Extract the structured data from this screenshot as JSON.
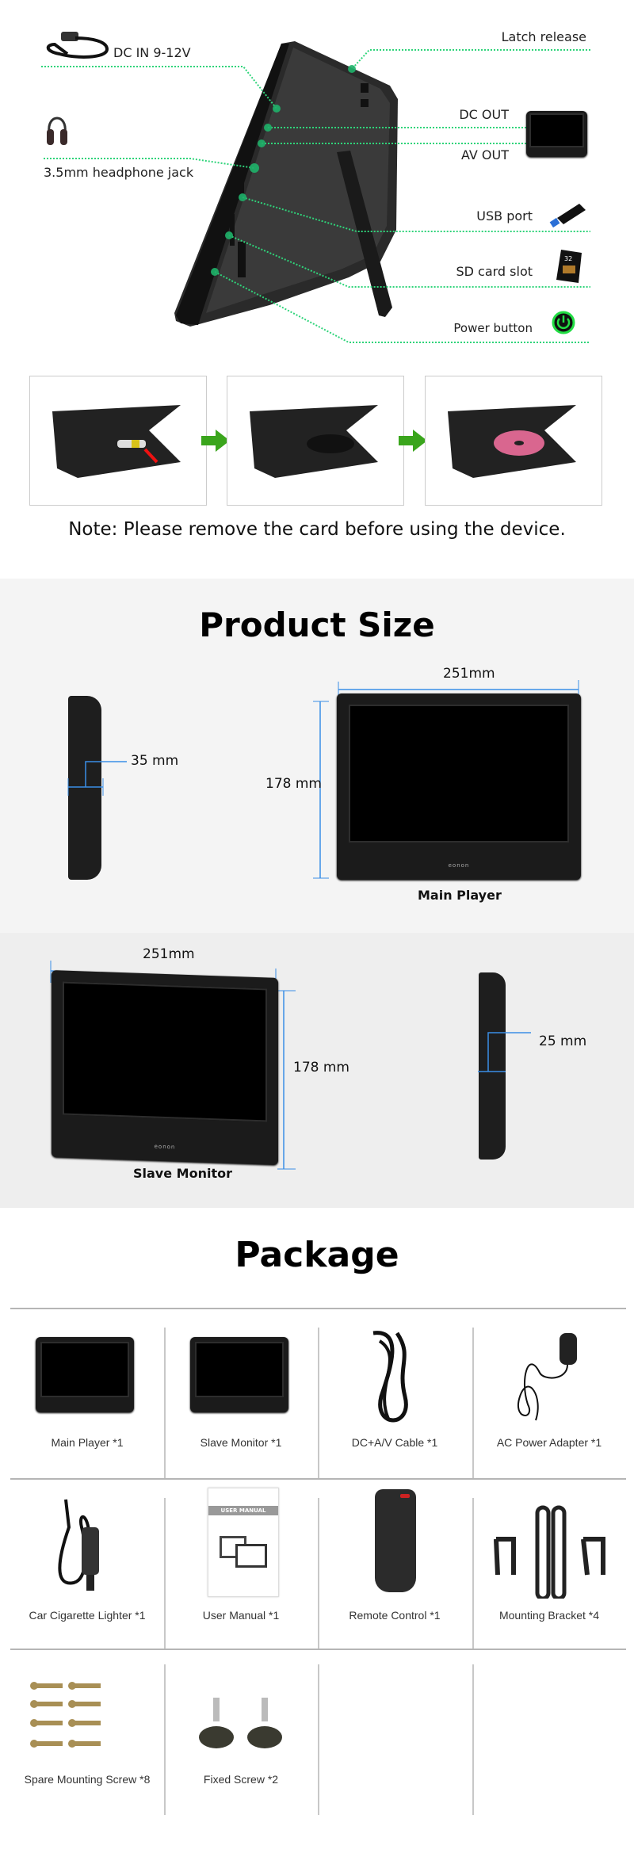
{
  "features": {
    "dc_in": "DC IN 9-12V",
    "headphone": "3.5mm headphone jack",
    "latch": "Latch release",
    "dc_out": "DC OUT",
    "av_out": "AV OUT",
    "usb": "USB port",
    "sd": "SD card slot",
    "power": "Power button",
    "sd_card_text": "32"
  },
  "steps": {
    "note": "Note: Please remove the card before using the device."
  },
  "product_size": {
    "title": "Product Size",
    "main_player": {
      "depth": "35 mm",
      "width": "251mm",
      "height": "178 mm",
      "label": "Main Player",
      "logo": "eonon"
    },
    "slave_monitor": {
      "width": "251mm",
      "height": "178 mm",
      "depth": "25 mm",
      "label": "Slave Monitor",
      "logo": "eonon"
    }
  },
  "package": {
    "title": "Package",
    "items": [
      {
        "label": "Main Player *1",
        "icon": "main-player"
      },
      {
        "label": "Slave Monitor *1",
        "icon": "slave-monitor"
      },
      {
        "label": "DC+A/V Cable *1",
        "icon": "cable"
      },
      {
        "label": "AC Power Adapter *1",
        "icon": "ac-adapter"
      },
      {
        "label": "Car Cigarette Lighter *1",
        "icon": "car-charger"
      },
      {
        "label": "User Manual *1",
        "icon": "manual"
      },
      {
        "label": "Remote Control *1",
        "icon": "remote"
      },
      {
        "label": "Mounting Bracket *4",
        "icon": "bracket"
      },
      {
        "label": "Spare Mounting Screw *8",
        "icon": "screws"
      },
      {
        "label": "Fixed Screw *2",
        "icon": "fixed-screw"
      }
    ],
    "manual_title": "USER MANUAL"
  },
  "colors": {
    "callout_line": "#2fd47a",
    "dimension_line": "#3a8ee6",
    "arrow": "#3aa51c",
    "power_glow": "#22dd44"
  }
}
